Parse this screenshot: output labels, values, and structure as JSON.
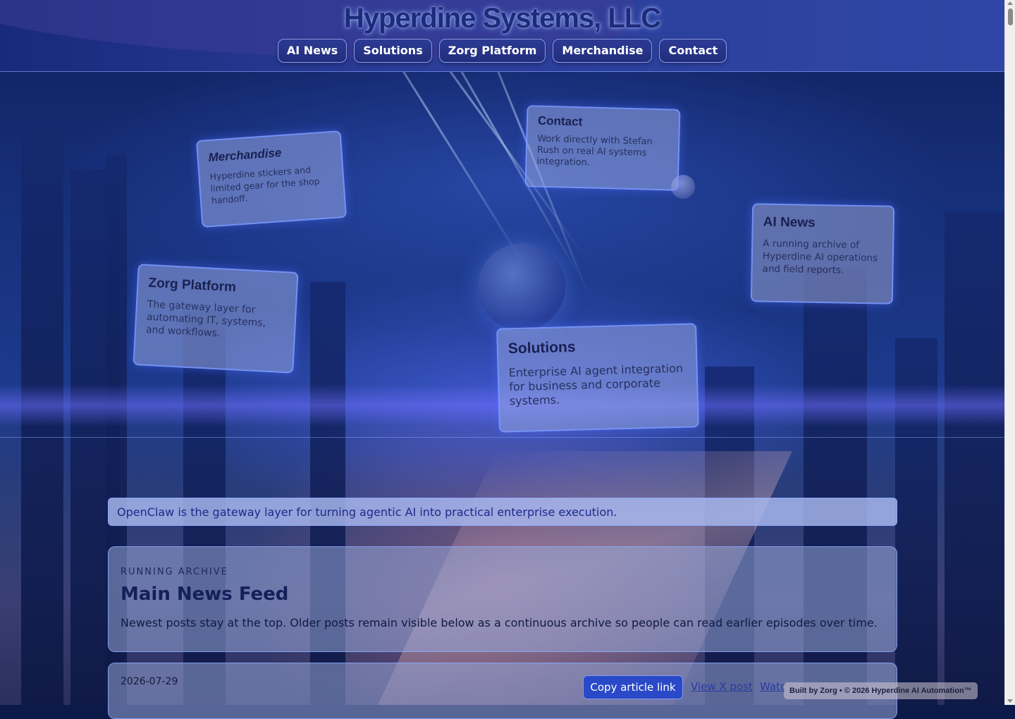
{
  "site": {
    "title": "Hyperdine Systems, LLC"
  },
  "nav": {
    "items": [
      {
        "label": "AI News"
      },
      {
        "label": "Solutions"
      },
      {
        "label": "Zorg Platform"
      },
      {
        "label": "Merchandise"
      },
      {
        "label": "Contact"
      }
    ]
  },
  "hero_cards": {
    "merchandise": {
      "title": "Merchandise",
      "text": "Hyperdine stickers and limited gear for the shop handoff."
    },
    "contact": {
      "title": "Contact",
      "text": "Work directly with Stefan Rush on real AI systems integration."
    },
    "ai_news": {
      "title": "AI News",
      "text": "A running archive of Hyperdine AI operations and field reports."
    },
    "zorg": {
      "title": "Zorg Platform",
      "text": "The gateway layer for automating IT, systems, and workflows."
    },
    "solutions": {
      "title": "Solutions",
      "text": "Enterprise AI agent integration for business and corporate systems."
    }
  },
  "tagline": "OpenClaw is the gateway layer for turning agentic AI into practical enterprise execution.",
  "archive": {
    "eyebrow": "RUNNING ARCHIVE",
    "title": "Main News Feed",
    "description": "Newest posts stay at the top. Older posts remain visible below as a continuous archive so people can read earlier episodes over time."
  },
  "post": {
    "date": "2026-07-29",
    "copy_label": "Copy article link",
    "view_label": "View X post",
    "watch_label": "Watc"
  },
  "footer": {
    "badge": "Built by Zorg • © 2026 Hyperdine AI Automation™"
  },
  "colors": {
    "accent": "#2a49c8",
    "header": "#2a3c98",
    "card_border": "#7896ff"
  }
}
